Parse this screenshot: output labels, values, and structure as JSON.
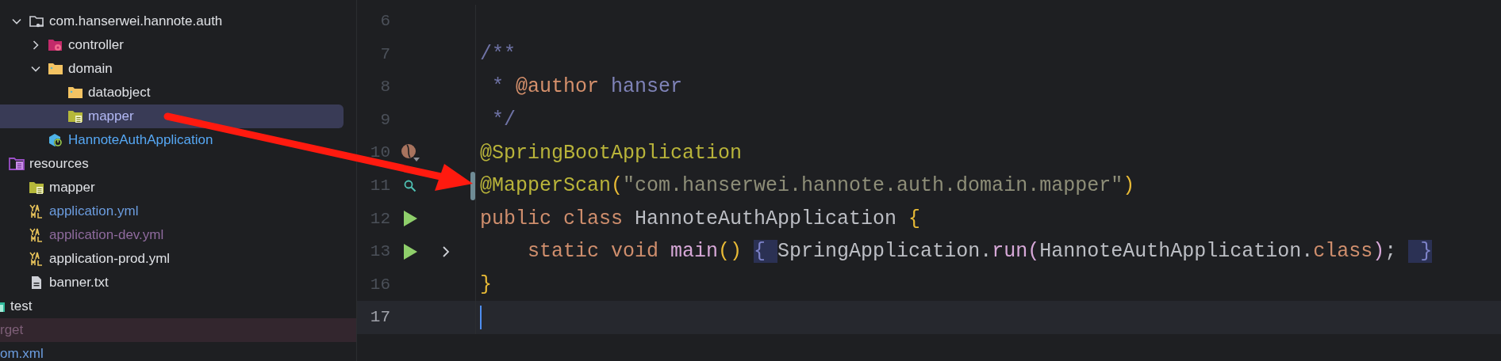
{
  "tree": [
    {
      "children": [
        {
          "children": [
            {
              "children": [
                {
                  "label": "com.hanserwei.hannote.auth",
                  "kind": "package",
                  "expanded": true,
                  "selected": false,
                  "excluded": false,
                  "color": "#dfe1e5",
                  "children": [
                    {
                      "label": "controller",
                      "kind": "folder-gear",
                      "expanded": false,
                      "selected": false,
                      "excluded": false,
                      "color": "#dfe1e5"
                    },
                    {
                      "label": "domain",
                      "kind": "folder",
                      "expanded": true,
                      "selected": false,
                      "excluded": false,
                      "color": "#dfe1e5",
                      "children": [
                        {
                          "label": "dataobject",
                          "kind": "folder",
                          "selected": false,
                          "excluded": false,
                          "color": "#dfe1e5"
                        },
                        {
                          "label": "mapper",
                          "kind": "folder-list",
                          "selected": true,
                          "excluded": false,
                          "color": "#b3b9f5"
                        }
                      ]
                    },
                    {
                      "label": "HannoteAuthApplication",
                      "kind": "spring-class",
                      "selected": false,
                      "excluded": false,
                      "color": "#56a8f5"
                    }
                  ]
                }
              ]
            },
            {
              "label": "resources",
              "kind": "resources",
              "selected": false,
              "excluded": false,
              "color": "#dfe1e5",
              "children": [
                {
                  "label": "mapper",
                  "kind": "folder-list",
                  "selected": false,
                  "excluded": false,
                  "color": "#dfe1e5"
                },
                {
                  "label": "application.yml",
                  "kind": "yaml",
                  "selected": false,
                  "excluded": false,
                  "color": "#6c9de0"
                },
                {
                  "label": "application-dev.yml",
                  "kind": "yaml",
                  "selected": false,
                  "excluded": false,
                  "color": "#8f6b9e"
                },
                {
                  "label": "application-prod.yml",
                  "kind": "yaml",
                  "selected": false,
                  "excluded": false,
                  "color": "#dfe1e5"
                },
                {
                  "label": "banner.txt",
                  "kind": "text-file",
                  "selected": false,
                  "excluded": false,
                  "color": "#dfe1e5"
                }
              ]
            }
          ]
        },
        {
          "label": "test",
          "kind": "test-folder",
          "selected": false,
          "excluded": false,
          "color": "#dfe1e5"
        }
      ]
    },
    {
      "label": "rget",
      "selected": false,
      "excluded": true,
      "color": "#7e5f78"
    },
    {
      "label": "om.xml",
      "selected": false,
      "excluded": false,
      "color": "#6c9de0"
    }
  ],
  "editor": {
    "lines": [
      {
        "number": "6",
        "current": false,
        "changed": false
      },
      {
        "number": "7",
        "current": false,
        "changed": false,
        "tokens": [
          {
            "kind": "doc",
            "text": "/**"
          }
        ]
      },
      {
        "number": "8",
        "current": false,
        "changed": false,
        "tokens": [
          {
            "kind": "doc",
            "text": " * "
          },
          {
            "kind": "doctag",
            "text": "@author"
          },
          {
            "kind": "docval",
            "text": " hanser"
          }
        ]
      },
      {
        "number": "9",
        "current": false,
        "changed": false,
        "tokens": [
          {
            "kind": "doc",
            "text": " */"
          }
        ]
      },
      {
        "number": "10",
        "current": false,
        "changed": false,
        "kind": "bean",
        "tokens": [
          {
            "kind": "ann",
            "text": "@SpringBootApplication"
          }
        ]
      },
      {
        "number": "11",
        "current": false,
        "changed": true,
        "kind": "search",
        "tokens": [
          {
            "kind": "ann",
            "text": "@MapperScan"
          },
          {
            "kind": "br1",
            "text": "("
          },
          {
            "kind": "str",
            "text": "\"com.hanserwei.hannote.auth.domain.mapper\""
          },
          {
            "kind": "br1",
            "text": ")"
          }
        ]
      },
      {
        "number": "12",
        "current": false,
        "changed": false,
        "kind": "run",
        "tokens": [
          {
            "kind": "kw",
            "text": "public class "
          },
          {
            "kind": "cls",
            "text": "HannoteAuthApplication "
          },
          {
            "kind": "br1",
            "text": "{"
          }
        ]
      },
      {
        "number": "13",
        "current": false,
        "changed": false,
        "kind": "run",
        "folded": true,
        "tokens": [
          {
            "kind": "kw",
            "text": "    static void "
          },
          {
            "kind": "meth",
            "text": "main"
          },
          {
            "kind": "br1",
            "text": "() "
          },
          {
            "kind": "fold",
            "text": "{ "
          },
          {
            "kind": "cls",
            "text": "SpringApplication."
          },
          {
            "kind": "meth",
            "text": "run"
          },
          {
            "kind": "br2",
            "text": "("
          },
          {
            "kind": "cls",
            "text": "HannoteAuthApplication."
          },
          {
            "kind": "kw",
            "text": "class"
          },
          {
            "kind": "br2",
            "text": ")"
          },
          {
            "kind": "cls",
            "text": "; "
          },
          {
            "kind": "fold",
            "text": " }"
          }
        ]
      },
      {
        "number": "16",
        "current": false,
        "changed": false,
        "tokens": [
          {
            "kind": "br1",
            "text": "}"
          }
        ]
      },
      {
        "number": "17",
        "current": true,
        "changed": false
      }
    ]
  }
}
